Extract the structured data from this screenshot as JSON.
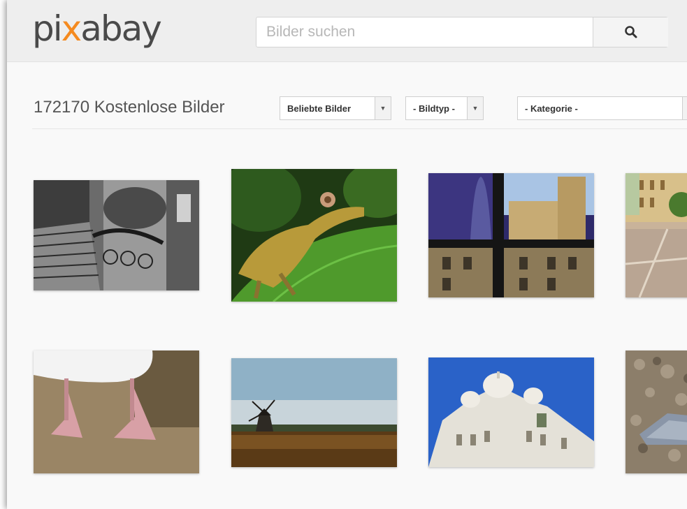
{
  "logo": {
    "text_1": "pi",
    "text_accent": "x",
    "text_2": "abay"
  },
  "search": {
    "placeholder": "Bilder suchen",
    "button_icon": "search-icon"
  },
  "toolbar": {
    "count_label": "172170 Kostenlose Bilder",
    "filters": [
      {
        "selected": "Beliebte Bilder"
      },
      {
        "selected": "- Bildtyp -"
      },
      {
        "selected": "- Kategorie -"
      }
    ]
  },
  "colors": {
    "accent": "#f58a1f",
    "logo": "#4a4a4a",
    "background": "#f9f9f9"
  },
  "gallery": {
    "rows": [
      [
        "staircase-photo",
        "gecko-photo",
        "window-city-photo",
        "street-photo"
      ],
      [
        "goose-feet-photo",
        "windmill-photo",
        "basilica-photo",
        "rocks-photo"
      ]
    ]
  }
}
